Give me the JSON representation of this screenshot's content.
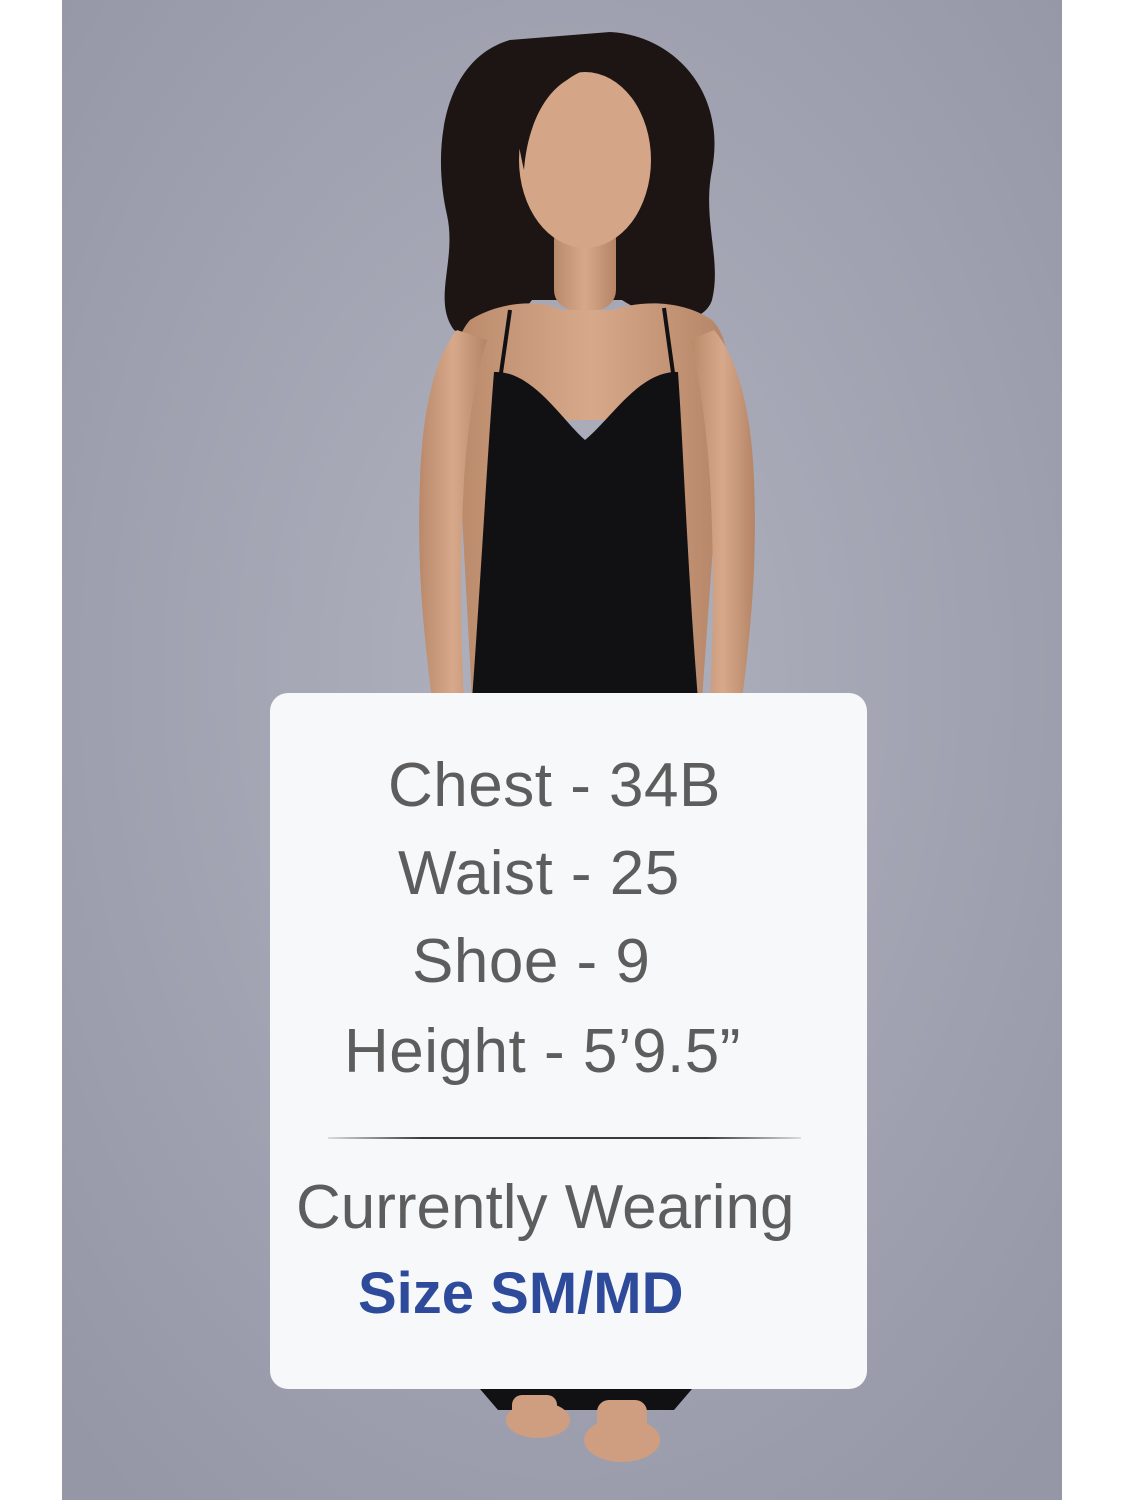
{
  "measurements": {
    "chest": "Chest - 34B",
    "waist": "Waist - 25",
    "shoe": "Shoe - 9",
    "height": "Height - 5’9.5”"
  },
  "currently_wearing": {
    "label": "Currently Wearing",
    "size": "Size SM/MD"
  },
  "colors": {
    "background": "#a3a5b3",
    "card": "#f7f8f9",
    "text": "#5d5d5d",
    "size_text": "#2e4a9a",
    "garment": "#111114"
  },
  "icons": [
    "model-photo"
  ]
}
